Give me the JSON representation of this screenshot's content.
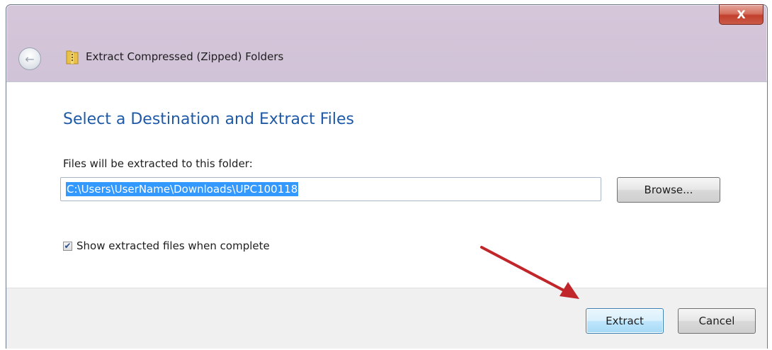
{
  "window": {
    "title": "Extract Compressed (Zipped) Folders",
    "close_glyph": "X"
  },
  "header": {
    "back_icon": "back-arrow-icon",
    "folder_icon": "zip-folder-icon"
  },
  "main": {
    "heading": "Select a Destination and Extract Files",
    "folder_label": "Files will be extracted to this folder:",
    "path_value": "C:\\Users\\UserName\\Downloads\\UPC100118",
    "browse_label": "Browse...",
    "checkbox_label": "Show extracted files when complete",
    "checkbox_checked": true
  },
  "footer": {
    "extract_label": "Extract",
    "cancel_label": "Cancel"
  },
  "colors": {
    "heading": "#1f5aa8",
    "selection": "#3399ff",
    "arrow": "#c0262a"
  }
}
